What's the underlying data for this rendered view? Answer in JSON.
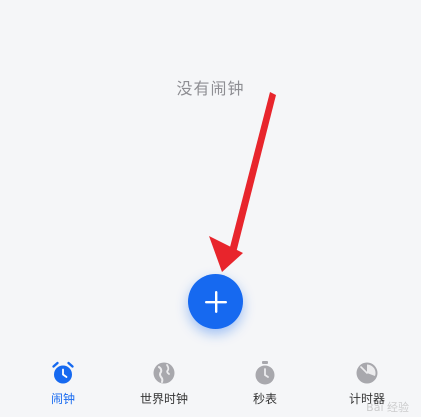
{
  "empty_state": {
    "message": "没有闹钟"
  },
  "fab": {
    "icon": "plus-icon",
    "color": "#1669f0"
  },
  "annotation": {
    "arrow_color": "#e8252c"
  },
  "tabs": [
    {
      "label": "闹钟",
      "icon": "alarm-clock-icon",
      "active": true
    },
    {
      "label": "世界时钟",
      "icon": "globe-icon",
      "active": false
    },
    {
      "label": "秒表",
      "icon": "stopwatch-icon",
      "active": false
    },
    {
      "label": "计时器",
      "icon": "timer-icon",
      "active": false
    }
  ],
  "colors": {
    "background": "#f5f6f8",
    "accent": "#1669f0",
    "inactive_icon": "#a8a8ad"
  },
  "watermark": "Bai 经验"
}
